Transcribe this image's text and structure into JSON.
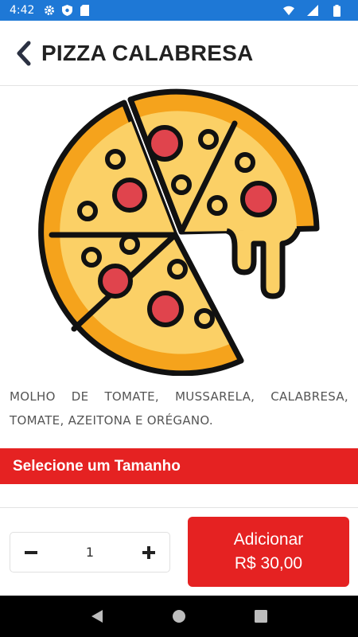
{
  "status_bar": {
    "time": "4:42",
    "icons_left": [
      "gear-icon",
      "shield-icon",
      "sd-card-icon"
    ],
    "icons_right": [
      "wifi-icon",
      "signal-icon",
      "battery-icon"
    ],
    "color": "#1e78d6"
  },
  "header": {
    "title": "PIZZA CALABRESA",
    "back_icon": "chevron-left-icon"
  },
  "product": {
    "image_icon": "pizza-icon",
    "description": "MOLHO DE TOMATE, MUSSARELA, CALABRESA, TOMATE, AZEITONA E ORÉGANO."
  },
  "size_selector": {
    "label": "Selecione um Tamanho",
    "color": "#e52222"
  },
  "quantity": {
    "value": "1",
    "minus_icon": "minus-icon",
    "plus_icon": "plus-icon"
  },
  "add_button": {
    "label": "Adicionar",
    "price": "R$ 30,00",
    "color": "#e52222"
  },
  "nav_bar": {
    "icons": [
      "back-triangle-icon",
      "home-circle-icon",
      "recents-square-icon"
    ]
  }
}
